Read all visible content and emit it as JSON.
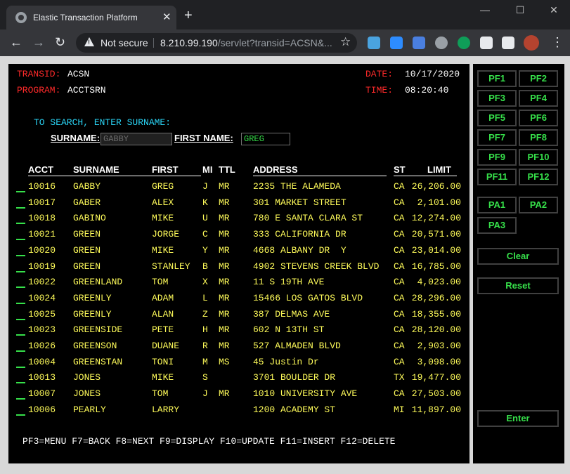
{
  "browser": {
    "tab_title": "Elastic Transaction Platform",
    "security": "Not secure",
    "url_host": "8.210.99.190",
    "url_path": "/servlet?transid=ACSN&..."
  },
  "screen": {
    "transid_label": "TRANSID:",
    "transid_value": "ACSN",
    "program_label": "PROGRAM:",
    "program_value": "ACCTSRN",
    "date_label": "DATE:",
    "date_value": "10/17/2020",
    "time_label": "TIME:",
    "time_value": "08:20:40",
    "prompt": "TO SEARCH, ENTER SURNAME:",
    "surname_label": "SURNAME:",
    "surname_value": "GABBY",
    "firstname_label": "FIRST NAME:",
    "firstname_value": "GREG",
    "columns": {
      "acct": "ACCT",
      "surname": "SURNAME",
      "first": "FIRST",
      "mi": "MI",
      "ttl": "TTL",
      "address": "ADDRESS",
      "st": "ST",
      "limit": "LIMIT"
    },
    "rows": [
      {
        "acct": "10016",
        "surname": "GABBY",
        "first": "GREG",
        "mi": "J",
        "ttl": "MR",
        "address": "2235 THE ALAMEDA",
        "st": "CA",
        "limit": "26,206.00"
      },
      {
        "acct": "10017",
        "surname": "GABER",
        "first": "ALEX",
        "mi": "K",
        "ttl": "MR",
        "address": "301 MARKET STREET",
        "st": "CA",
        "limit": "2,101.00"
      },
      {
        "acct": "10018",
        "surname": "GABINO",
        "first": "MIKE",
        "mi": "U",
        "ttl": "MR",
        "address": "780 E SANTA CLARA ST",
        "st": "CA",
        "limit": "12,274.00"
      },
      {
        "acct": "10021",
        "surname": "GREEN",
        "first": "JORGE",
        "mi": "C",
        "ttl": "MR",
        "address": "333 CALIFORNIA DR",
        "st": "CA",
        "limit": "20,571.00"
      },
      {
        "acct": "10020",
        "surname": "GREEN",
        "first": "MIKE",
        "mi": "Y",
        "ttl": "MR",
        "address": "4668 ALBANY DR  Y",
        "st": "CA",
        "limit": "23,014.00"
      },
      {
        "acct": "10019",
        "surname": "GREEN",
        "first": "STANLEY",
        "mi": "B",
        "ttl": "MR",
        "address": "4902 STEVENS CREEK BLVD",
        "st": "CA",
        "limit": "16,785.00"
      },
      {
        "acct": "10022",
        "surname": "GREENLAND",
        "first": "TOM",
        "mi": "X",
        "ttl": "MR",
        "address": "11 S 19TH AVE",
        "st": "CA",
        "limit": "4,023.00"
      },
      {
        "acct": "10024",
        "surname": "GREENLY",
        "first": "ADAM",
        "mi": "L",
        "ttl": "MR",
        "address": "15466 LOS GATOS BLVD",
        "st": "CA",
        "limit": "28,296.00"
      },
      {
        "acct": "10025",
        "surname": "GREENLY",
        "first": "ALAN",
        "mi": "Z",
        "ttl": "MR",
        "address": "387 DELMAS AVE",
        "st": "CA",
        "limit": "18,355.00"
      },
      {
        "acct": "10023",
        "surname": "GREENSIDE",
        "first": "PETE",
        "mi": "H",
        "ttl": "MR",
        "address": "602 N 13TH ST",
        "st": "CA",
        "limit": "28,120.00"
      },
      {
        "acct": "10026",
        "surname": "GREENSON",
        "first": "DUANE",
        "mi": "R",
        "ttl": "MR",
        "address": "527 ALMADEN BLVD",
        "st": "CA",
        "limit": "2,903.00"
      },
      {
        "acct": "10004",
        "surname": "GREENSTAN",
        "first": "TONI",
        "mi": "M",
        "ttl": "MS",
        "address": "45 Justin Dr",
        "st": "CA",
        "limit": "3,098.00"
      },
      {
        "acct": "10013",
        "surname": "JONES",
        "first": "MIKE",
        "mi": "S",
        "ttl": "",
        "address": "3701 BOULDER DR",
        "st": "TX",
        "limit": "19,477.00"
      },
      {
        "acct": "10007",
        "surname": "JONES",
        "first": "TOM",
        "mi": "J",
        "ttl": "MR",
        "address": "1010 UNIVERSITY AVE",
        "st": "CA",
        "limit": "27,503.00"
      },
      {
        "acct": "10006",
        "surname": "PEARLY",
        "first": "LARRY",
        "mi": "",
        "ttl": "",
        "address": "1200 ACADEMY ST",
        "st": "MI",
        "limit": "11,897.00"
      }
    ],
    "footer": "PF3=MENU F7=BACK F8=NEXT F9=DISPLAY F10=UPDATE F11=INSERT F12=DELETE"
  },
  "keys": {
    "pf": [
      "PF1",
      "PF2",
      "PF3",
      "PF4",
      "PF5",
      "PF6",
      "PF7",
      "PF8",
      "PF9",
      "PF10",
      "PF11",
      "PF12"
    ],
    "pa": [
      "PA1",
      "PA2",
      "PA3"
    ],
    "clear": "Clear",
    "reset": "Reset",
    "enter": "Enter"
  }
}
